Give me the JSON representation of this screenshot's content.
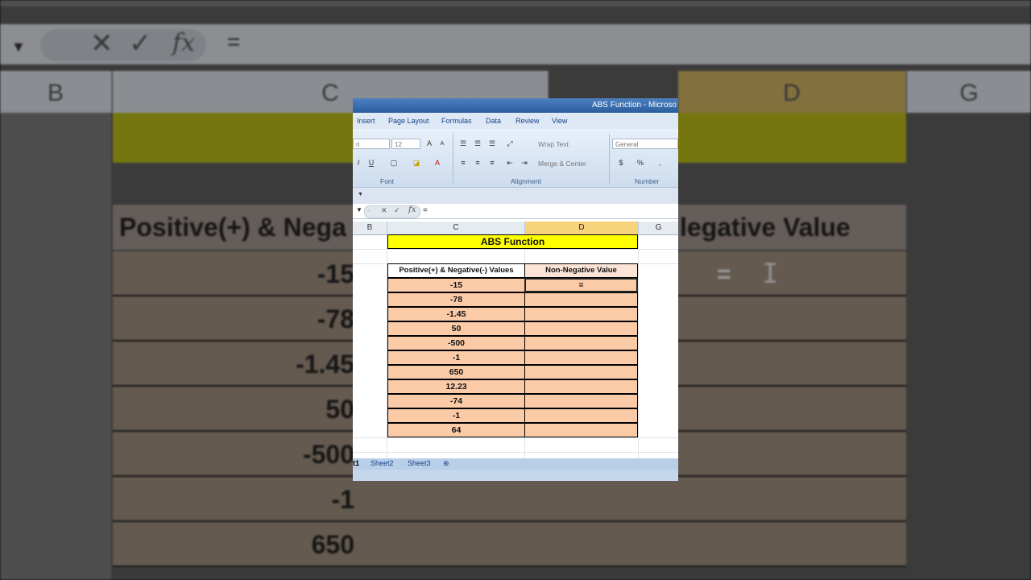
{
  "app": {
    "window_title": "ABS Function - Microso"
  },
  "ribbon": {
    "tabs": [
      "Insert",
      "Page Layout",
      "Formulas",
      "Data",
      "Review",
      "View"
    ],
    "font_name": "ri",
    "font_size": "12",
    "wrap_text": "Wrap Text",
    "merge_center": "Merge & Center",
    "number_format": "General",
    "groups": [
      "Font",
      "Alignment",
      "Number"
    ],
    "percent": "%"
  },
  "formula_bar": {
    "fx": "fx",
    "value": "="
  },
  "columns": [
    "B",
    "C",
    "D",
    "G"
  ],
  "sheet": {
    "title": "ABS Function",
    "header_c": "Positive(+) & Negative(-) Values",
    "header_d": "Non-Negative Value",
    "active_cell_value": "=",
    "values": [
      "-15",
      "-78",
      "-1.45",
      "50",
      "-500",
      "-1",
      "650",
      "12.23",
      "-74",
      "-1",
      "64"
    ]
  },
  "sheet_tabs": [
    "t1",
    "Sheet2",
    "Sheet3"
  ],
  "background": {
    "header_left": "Positive(+) & Nega",
    "header_right": "legative Value",
    "values": [
      "-15",
      "-78",
      "-1.45",
      "50",
      "-500",
      "-1",
      "650"
    ],
    "formula_value": "="
  },
  "colors": {
    "title_fill": "#ffff00",
    "cell_fill": "#fbcaa7",
    "selected_col": "#f7d37c"
  }
}
